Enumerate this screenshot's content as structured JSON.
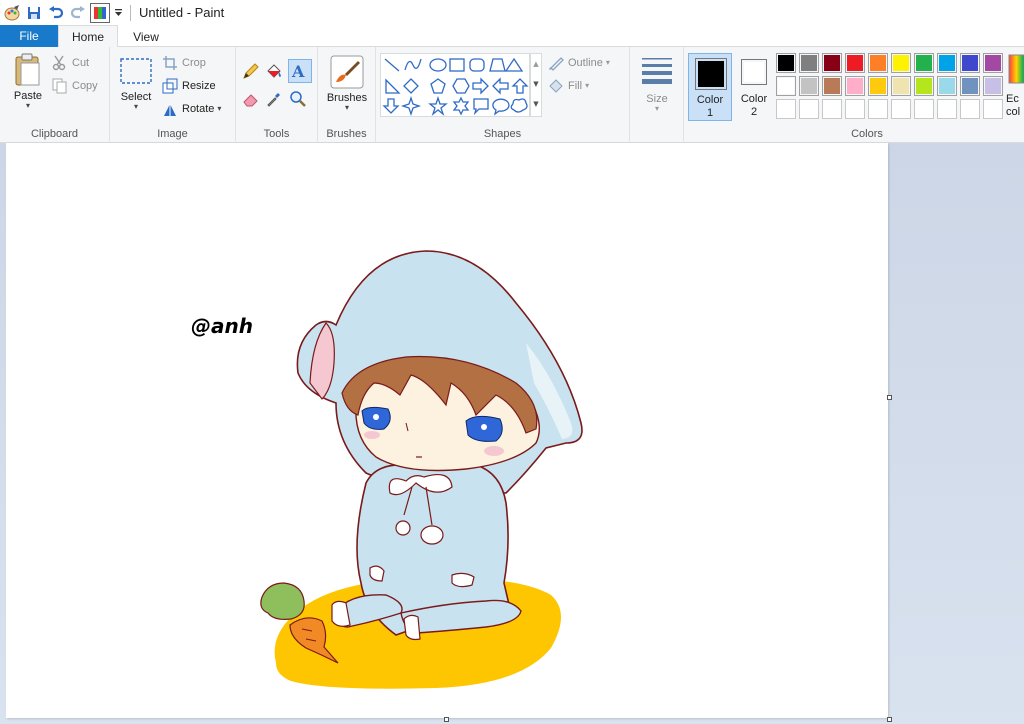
{
  "window": {
    "title": "Untitled - Paint"
  },
  "tabs": {
    "file": "File",
    "home": "Home",
    "view": "View"
  },
  "clipboard": {
    "paste": "Paste",
    "cut": "Cut",
    "copy": "Copy",
    "label": "Clipboard"
  },
  "image": {
    "select": "Select",
    "crop": "Crop",
    "resize": "Resize",
    "rotate": "Rotate",
    "label": "Image"
  },
  "tools": {
    "label": "Tools"
  },
  "brushes": {
    "label": "Brushes"
  },
  "shapes": {
    "outline": "Outline",
    "fill": "Fill",
    "label": "Shapes"
  },
  "size": {
    "label": "Size"
  },
  "colors": {
    "color1_label": "Color",
    "color1_num": "1",
    "color2_label": "Color",
    "color2_num": "2",
    "edit_label_1": "Ec",
    "edit_label_2": "col",
    "label": "Colors",
    "color1": "#000000",
    "color2": "#ffffff",
    "palette_row1": [
      "#000000",
      "#7f7f7f",
      "#880015",
      "#ed1c24",
      "#ff7f27",
      "#fff200",
      "#22b14c",
      "#00a2e8",
      "#3f48cc",
      "#a349a4"
    ],
    "palette_row2": [
      "#ffffff",
      "#c3c3c3",
      "#b97a57",
      "#ffaec9",
      "#ffc90e",
      "#efe4b0",
      "#b5e61d",
      "#99d9ea",
      "#7092be",
      "#c8bfe7"
    ]
  },
  "canvas": {
    "signature": "@anh"
  }
}
